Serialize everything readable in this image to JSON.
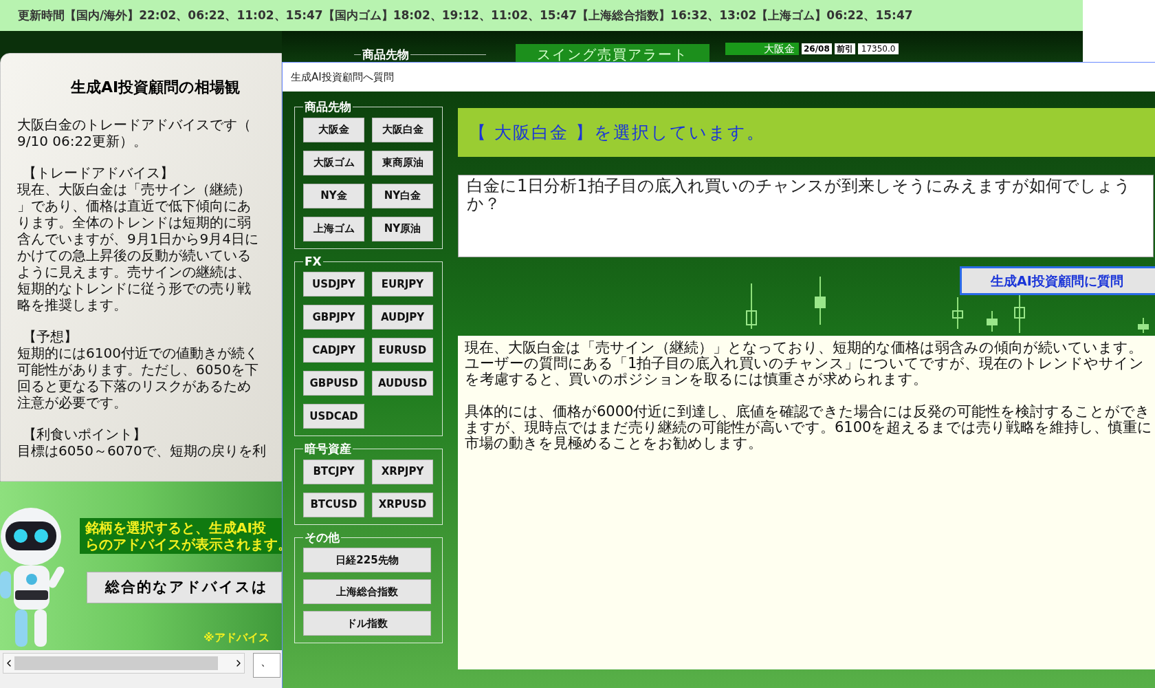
{
  "update_bar": {
    "text": "更新時間【国内/海外】22:02、06:22、11:02、15:47【国内ゴム】18:02、19:12、11:02、15:47【上海総合指数】16:32、13:02【上海ゴム】06:22、15:47"
  },
  "toolbar": {
    "group_label": "商品先物",
    "alert_button": "スイング売買アラート",
    "quote": {
      "symbol": "大阪金",
      "contract": "26/08",
      "session": "前引",
      "price": "17350.0"
    }
  },
  "advice_panel": {
    "title": "生成AI投資顧問の相場観",
    "lines": [
      {
        "kind": "body",
        "text": "大阪白金のトレードアドバイスです（"
      },
      {
        "kind": "body",
        "text": "9/10 06:22更新）。"
      },
      {
        "kind": "heading",
        "text": "【トレードアドバイス】"
      },
      {
        "kind": "body",
        "text": "現在、大阪白金は「売サイン（継続）"
      },
      {
        "kind": "body",
        "text": "」であり、価格は直近で低下傾向にあ"
      },
      {
        "kind": "body",
        "text": "ります。全体のトレンドは短期的に弱"
      },
      {
        "kind": "body",
        "text": "含んでいますが、9月1日から9月4日に"
      },
      {
        "kind": "body",
        "text": "かけての急上昇後の反動が続いている"
      },
      {
        "kind": "body",
        "text": "ように見えます。売サインの継続は、"
      },
      {
        "kind": "body",
        "text": "短期的なトレンドに従う形での売り戦"
      },
      {
        "kind": "body",
        "text": "略を推奨します。"
      },
      {
        "kind": "heading",
        "text": "【予想】"
      },
      {
        "kind": "body",
        "text": "短期的には6100付近での値動きが続く"
      },
      {
        "kind": "body",
        "text": "可能性があります。ただし、6050を下"
      },
      {
        "kind": "body",
        "text": "回ると更なる下落のリスクがあるため"
      },
      {
        "kind": "body",
        "text": "注意が必要です。"
      },
      {
        "kind": "heading",
        "text": "【利食いポイント】"
      },
      {
        "kind": "body",
        "text": "目標は6050～6070で、短期の戻りを利"
      }
    ]
  },
  "banner": {
    "message_lines": [
      "銘柄を選択すると、生成AI投",
      "らのアドバイスが表示されます。"
    ],
    "button": "総合的なアドバイスは",
    "note": "※アドバイス"
  },
  "side_box_text": "、",
  "dialog": {
    "title": "生成AI投資顧問へ質問",
    "groups": [
      {
        "label": "商品先物",
        "buttons": [
          "大阪金",
          "大阪白金",
          "大阪ゴム",
          "東商原油",
          "NY金",
          "NY白金",
          "上海ゴム",
          "NY原油"
        ]
      },
      {
        "label": "FX",
        "buttons": [
          "USDJPY",
          "EURJPY",
          "GBPJPY",
          "AUDJPY",
          "CADJPY",
          "EURUSD",
          "GBPUSD",
          "AUDUSD",
          "USDCAD"
        ]
      },
      {
        "label": "暗号資産",
        "buttons": [
          "BTCJPY",
          "XRPJPY",
          "BTCUSD",
          "XRPUSD"
        ]
      },
      {
        "label": "その他",
        "wide": true,
        "buttons": [
          "日経225先物",
          "上海総合指数",
          "ドル指数"
        ]
      }
    ],
    "selected_label": "【 大阪白金 】を選択しています。",
    "question": "白金に1日分析1拍子目の底入れ買いのチャンスが到来しそうにみえますが如何でしょうか？",
    "ask_button": "生成AI投資顧問に質問",
    "answer": [
      "現在、大阪白金は「売サイン（継続）」となっており、短期的な価格は弱含みの傾向が続いています。ユーザーの質問にある「1拍子目の底入れ買いのチャンス」についてですが、現在のトレンドやサインを考慮すると、買いのポジションを取るには慎重さが求められます。",
      "具体的には、価格が6000付近に到達し、底値を確認できた場合には反発の可能性を検討することができますが、現時点ではまだ売り継続の可能性が高いです。6100を超えるまでは売り戦略を維持し、慎重に市場の動きを見極めることをお勧めします。"
    ]
  }
}
